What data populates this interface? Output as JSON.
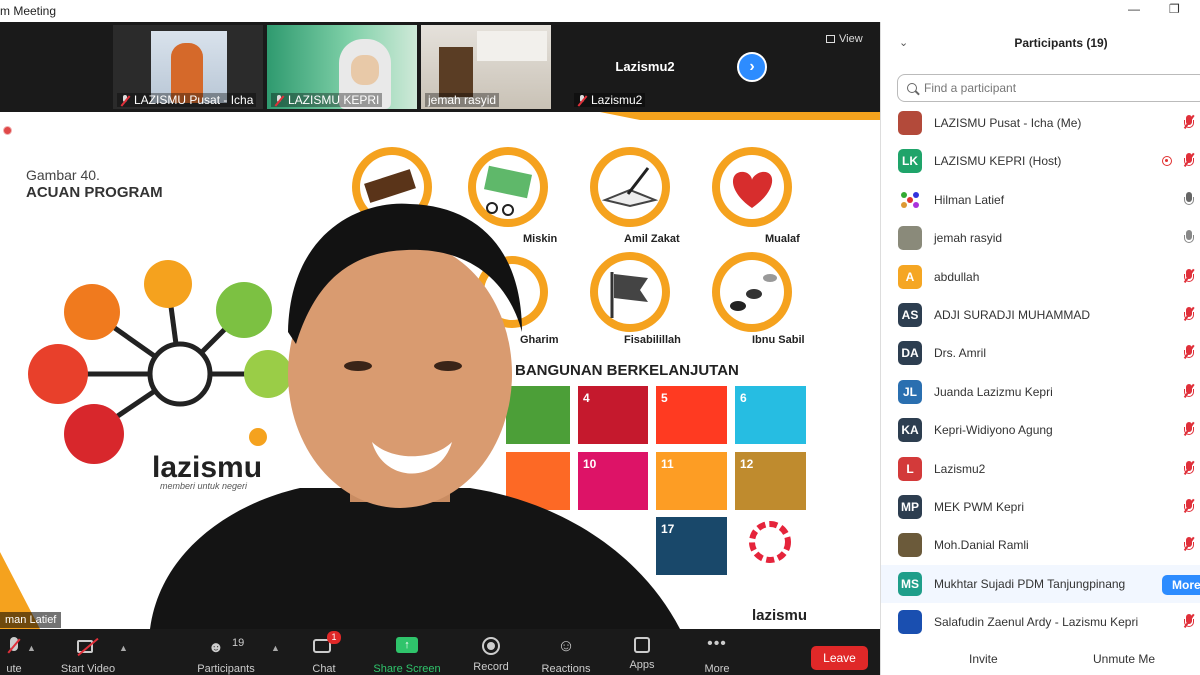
{
  "window": {
    "title": "m Meeting"
  },
  "strip": {
    "thumbs": [
      {
        "name": "LAZISMU Pusat - Icha"
      },
      {
        "name": "LAZISMU KEPRI"
      },
      {
        "name": "jemah rasyid"
      },
      {
        "name": "Lazismu2"
      }
    ],
    "center_label": "Lazismu2",
    "view_label": "View"
  },
  "slide": {
    "caption_top": "Gambar 40.",
    "caption_bottom": "ACUAN PROGRAM",
    "asnaf": [
      "Miskin",
      "Amil Zakat",
      "Mualaf",
      "Gharim",
      "Fisabilillah",
      "Ibnu Sabil"
    ],
    "sdg_heading": "BANGUNAN BERKELANJUTAN",
    "sdg_numbers": [
      "4",
      "5",
      "6",
      "10",
      "11",
      "12",
      "17"
    ],
    "brand": "lazismu",
    "tagline": "memberi untuk negeri",
    "brand_small": "lazismu"
  },
  "speaker": {
    "name_tag": "man Latief"
  },
  "toolbar": {
    "mute": "ute",
    "start_video": "Start Video",
    "participants": "Participants",
    "participants_count": "19",
    "chat": "Chat",
    "chat_badge": "1",
    "share": "Share Screen",
    "record": "Record",
    "reactions": "Reactions",
    "apps": "Apps",
    "more": "More",
    "leave": "Leave"
  },
  "panel": {
    "title": "Participants (19)",
    "search_placeholder": "Find a participant",
    "participants": [
      {
        "name": "LAZISMU Pusat - Icha (Me)",
        "initials": "",
        "color": "#b34a3a",
        "mic": "muted"
      },
      {
        "name": "LAZISMU KEPRI (Host)",
        "initials": "LK",
        "color": "#1fa46a",
        "mic": "muted",
        "recording": true
      },
      {
        "name": "Hilman Latief",
        "initials": "",
        "color": "#ffffff",
        "mic": "on"
      },
      {
        "name": "jemah rasyid",
        "initials": "",
        "color": "#8a8a7a",
        "mic": "off"
      },
      {
        "name": "abdullah",
        "initials": "A",
        "color": "#f5a623",
        "mic": "muted"
      },
      {
        "name": "ADJI SURADJI MUHAMMAD",
        "initials": "AS",
        "color": "#2d3e50",
        "mic": "muted"
      },
      {
        "name": "Drs. Amril",
        "initials": "DA",
        "color": "#2d3e50",
        "mic": "muted"
      },
      {
        "name": "Juanda Lazizmu Kepri",
        "initials": "JL",
        "color": "#2a6fb0",
        "mic": "muted"
      },
      {
        "name": "Kepri-Widiyono Agung",
        "initials": "KA",
        "color": "#2d3e50",
        "mic": "muted"
      },
      {
        "name": "Lazismu2",
        "initials": "L",
        "color": "#d33a3a",
        "mic": "muted"
      },
      {
        "name": "MEK PWM Kepri",
        "initials": "MP",
        "color": "#2d3e50",
        "mic": "muted"
      },
      {
        "name": "Moh.Danial Ramli",
        "initials": "",
        "color": "#6b5a3a",
        "mic": "muted"
      },
      {
        "name": "Mukhtar Sujadi PDM Tanjungpinang",
        "initials": "MS",
        "color": "#1f9e8a",
        "mic": "more"
      },
      {
        "name": "Salafudin Zaenul Ardy - Lazismu Kepri",
        "initials": "",
        "color": "#1a4fb0",
        "mic": "muted"
      }
    ],
    "more_label": "More",
    "invite": "Invite",
    "unmute_me": "Unmute Me"
  }
}
